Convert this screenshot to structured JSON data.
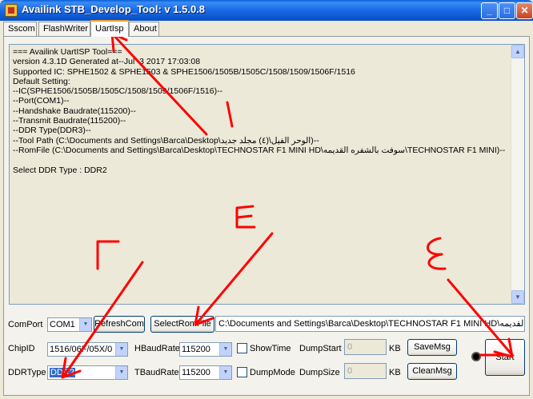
{
  "window": {
    "title": "Availink STB_Develop_Tool: v 1.5.0.8",
    "controls": {
      "minimize": "_",
      "maximize": "□",
      "close": "✕"
    }
  },
  "tabs": [
    {
      "label": "Sscom"
    },
    {
      "label": "FlashWriter"
    },
    {
      "label": "UartIsp"
    },
    {
      "label": "About"
    }
  ],
  "active_tab": "UartIsp",
  "log": {
    "lines": "=== Availink UartISP Tool===\nversion 4.3.1D Generated at--Jul  3 2017 17:03:08\nSupported IC: SPHE1502 & SPHE1503 & SPHE1506/1505B/1505C/1508/1509/1506F/1516\nDefault Setting:\n--IC(SPHE1506/1505B/1505C/1508/1509/1506F/1516)--\n--Port(COM1)--\n--Handshake Baudrate(115200)--\n--Transmit Baudrate(115200)--\n--DDR Type(DDR3)--\n--Tool Path (C:\\Documents and Settings\\Barca\\Desktop\\الوحر الفيل\\(٤) مجلد جديد)--\n--RomFile (C:\\Documents and Settings\\Barca\\Desktop\\TECHNOSTAR F1 MINI HD\\سوفت بالشفره القديمه\\TECHNOSTAR F1 MINI)--\n\nSelect DDR Type : DDR2"
  },
  "controls": {
    "comport_label": "ComPort",
    "comport_value": "COM1",
    "refresh_label": "RefreshCom",
    "selectrom_label": "SelectRomFile",
    "romfile_path": "C:\\Documents and Settings\\Barca\\Desktop\\TECHNOSTAR F1 MINI HD\\لقديمه",
    "chipid_label": "ChipID",
    "chipid_value": "1516/06F/05X/0",
    "hbaud_label": "HBaudRate",
    "hbaud_value": "115200",
    "showtime_label": "ShowTime",
    "dumpstart_label": "DumpStart",
    "dumpstart_value": "0",
    "kb1": "KB",
    "savemsg_label": "SaveMsg",
    "ddrtype_label": "DDRType",
    "ddrtype_value": "DDR2",
    "tbaud_label": "TBaudRate",
    "tbaud_value": "115200",
    "dumpmode_label": "DumpMode",
    "dumpsize_label": "DumpSize",
    "dumpsize_value": "0",
    "kb2": "KB",
    "cleanmsg_label": "CleanMsg",
    "start_label": "Start"
  },
  "annotations": {
    "color": "#ff0000",
    "marks": [
      "١",
      "٢",
      "٣",
      "٤"
    ]
  }
}
